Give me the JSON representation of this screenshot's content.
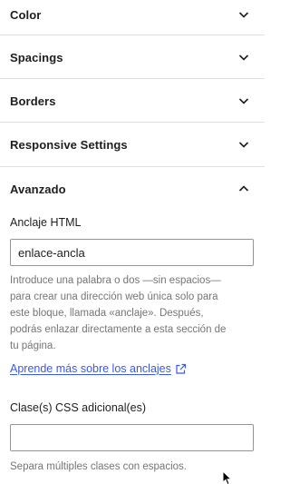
{
  "sections": [
    {
      "label": "Color",
      "expanded": false
    },
    {
      "label": "Spacings",
      "expanded": false
    },
    {
      "label": "Borders",
      "expanded": false
    },
    {
      "label": "Responsive Settings",
      "expanded": false
    },
    {
      "label": "Avanzado",
      "expanded": true
    }
  ],
  "advanced": {
    "anchor_label": "Anclaje HTML",
    "anchor_value": "enlace-ancla",
    "anchor_help_lines": [
      "Introduce una palabra o dos —sin espacios—",
      "para crear una dirección web única solo para",
      "este bloque, llamada «anclaje». Después,",
      "podrás enlazar directamente a esta sección de",
      "tu página."
    ],
    "anchor_link": "Aprende más sobre los anclajes",
    "css_label": "Clase(s) CSS adicional(es)",
    "css_value": "",
    "css_help": "Separa múltiples clases con espacios."
  },
  "colors": {
    "link": "#3858e9",
    "help_text": "#757575",
    "divider": "#e0e0e0"
  },
  "icons": [
    "chevron-down-icon",
    "chevron-up-icon",
    "external-link-icon",
    "mouse-cursor-icon"
  ]
}
